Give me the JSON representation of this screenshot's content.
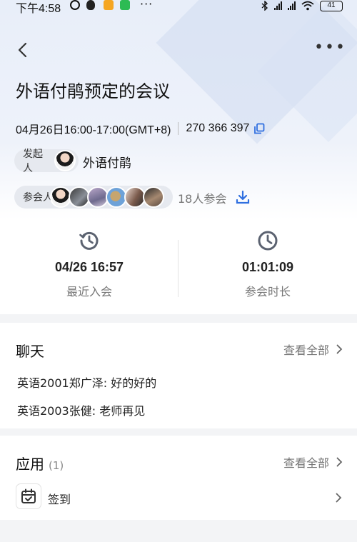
{
  "status_bar": {
    "time": "下午4:58",
    "battery": "41"
  },
  "meeting": {
    "title": "外语付鹃预定的会议",
    "time_range": "04月26日16:00-17:00(GMT+8)",
    "meeting_id": "270 366 397",
    "host_label": "发起人",
    "host_name": "外语付鹃",
    "attendees_label": "参会人",
    "attendee_count": "18人参会"
  },
  "stats": {
    "last_join_value": "04/26 16:57",
    "last_join_label": "最近入会",
    "duration_value": "01:01:09",
    "duration_label": "参会时长"
  },
  "chat": {
    "title": "聊天",
    "view_all": "查看全部",
    "messages": [
      {
        "text": "英语2001郑广泽: 好的好的"
      },
      {
        "text": "英语2003张健: 老师再见"
      }
    ]
  },
  "apps": {
    "title": "应用",
    "count": "(1)",
    "view_all": "查看全部",
    "items": [
      {
        "label": "签到"
      }
    ]
  },
  "colors": {
    "accent": "#2f6fe0",
    "icon_gray": "#5b6270"
  }
}
